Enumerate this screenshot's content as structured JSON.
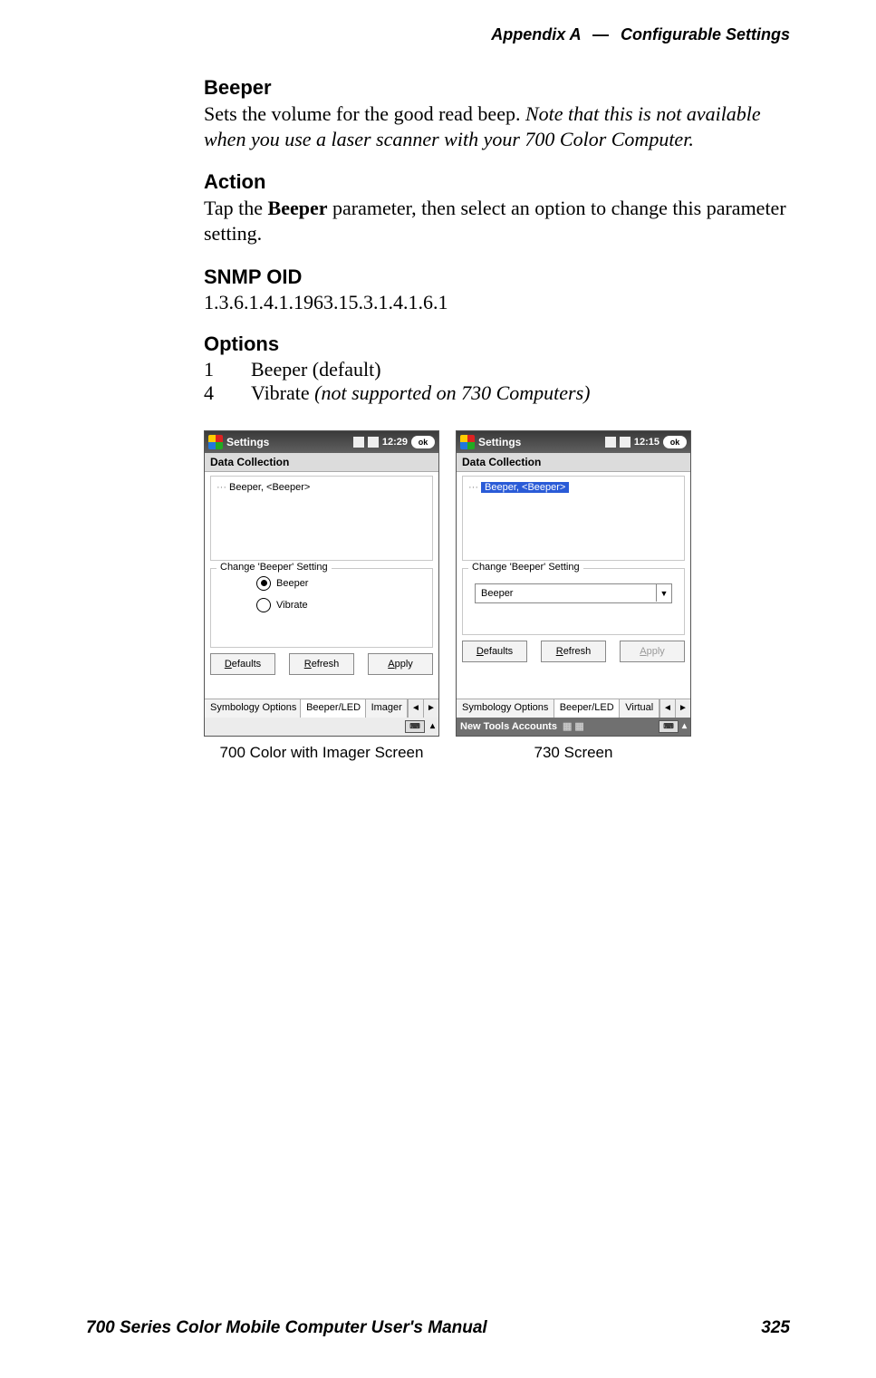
{
  "header": {
    "appendix": "Appendix A",
    "dash": "—",
    "title": "Configurable Settings"
  },
  "sections": {
    "beeper": {
      "heading": "Beeper",
      "body_plain": "Sets the volume for the good read beep. ",
      "body_italic": "Note that this is not available when you use a laser scanner with your 700 Color Computer."
    },
    "action": {
      "heading": "Action",
      "body_pre": "Tap the ",
      "body_bold": "Beeper",
      "body_post": " parameter, then select an option to change this parameter setting."
    },
    "snmp": {
      "heading": "SNMP OID",
      "value": "1.3.6.1.4.1.1963.15.3.1.4.1.6.1"
    },
    "options": {
      "heading": "Options",
      "rows": [
        {
          "num": "1",
          "label_plain": "Beeper (default)",
          "label_italic": ""
        },
        {
          "num": "4",
          "label_plain": "Vibrate ",
          "label_italic": "(not supported on 730 Computers)"
        }
      ]
    }
  },
  "screens": {
    "left": {
      "title": "Settings",
      "clock": "12:29",
      "ok": "ok",
      "subtitle": "Data Collection",
      "tree_item": "Beeper, <Beeper>",
      "group_legend": "Change 'Beeper' Setting",
      "radio1": "Beeper",
      "radio2": "Vibrate",
      "btn_defaults": "Defaults",
      "btn_refresh": "Refresh",
      "btn_apply": "Apply",
      "tab1": "Symbology Options",
      "tab2": "Beeper/LED",
      "tab3": "Imager",
      "caption": "700 Color with Imager Screen"
    },
    "right": {
      "title": "Settings",
      "clock": "12:15",
      "ok": "ok",
      "subtitle": "Data Collection",
      "tree_item": "Beeper, <Beeper>",
      "group_legend": "Change 'Beeper' Setting",
      "combo_value": "Beeper",
      "btn_defaults": "Defaults",
      "btn_refresh": "Refresh",
      "btn_apply": "Apply",
      "tab1": "Symbology Options",
      "tab2": "Beeper/LED",
      "tab3": "Virtual",
      "sip_text": "New Tools Accounts",
      "caption": "730 Screen"
    }
  },
  "footer": {
    "manual": "700 Series Color Mobile Computer User's Manual",
    "page": "325"
  }
}
